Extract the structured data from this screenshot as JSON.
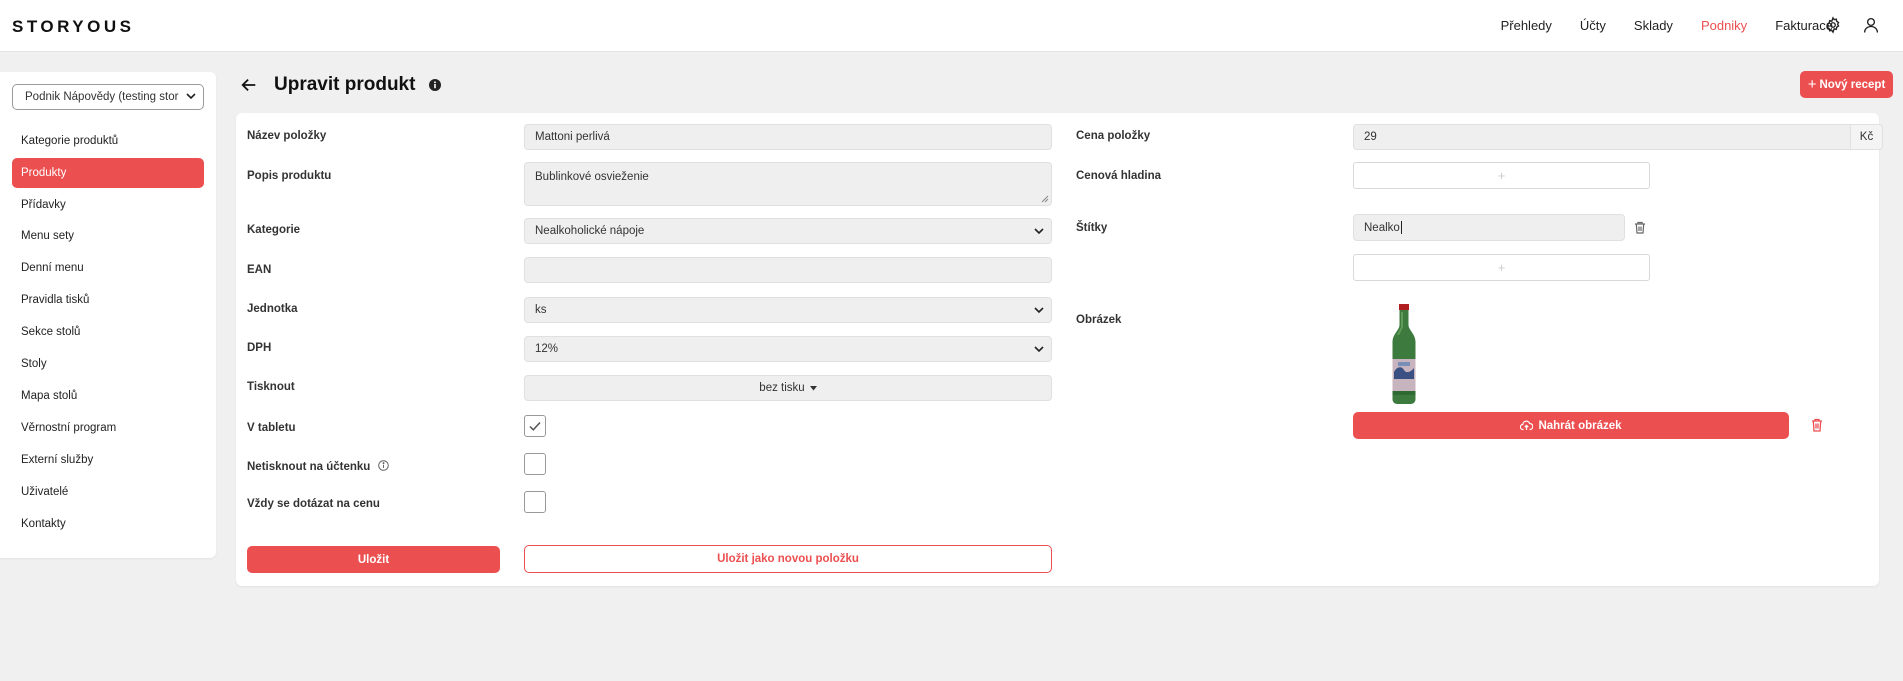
{
  "app": {
    "logo": "STORYOUS"
  },
  "nav": {
    "items": [
      {
        "label": "Přehledy",
        "active": false
      },
      {
        "label": "Účty",
        "active": false
      },
      {
        "label": "Sklady",
        "active": false
      },
      {
        "label": "Podniky",
        "active": true
      },
      {
        "label": "Fakturace",
        "active": false
      }
    ],
    "icons": [
      "gear-icon",
      "user-icon"
    ]
  },
  "sidebar": {
    "venue_select": "Podnik Nápovědy (testing stor",
    "items": [
      {
        "label": "Kategorie produktů",
        "active": false
      },
      {
        "label": "Produkty",
        "active": true
      },
      {
        "label": "Přídavky",
        "active": false
      },
      {
        "label": "Menu sety",
        "active": false
      },
      {
        "label": "Denní menu",
        "active": false
      },
      {
        "label": "Pravidla tisků",
        "active": false
      },
      {
        "label": "Sekce stolů",
        "active": false
      },
      {
        "label": "Stoly",
        "active": false
      },
      {
        "label": "Mapa stolů",
        "active": false
      },
      {
        "label": "Věrnostní program",
        "active": false
      },
      {
        "label": "Externí služby",
        "active": false
      },
      {
        "label": "Uživatelé",
        "active": false
      },
      {
        "label": "Kontakty",
        "active": false
      }
    ]
  },
  "header": {
    "title": "Upravit produkt",
    "new_recipe_label": "Nový recept"
  },
  "form": {
    "name": {
      "label": "Název položky",
      "value": "Mattoni perlivá"
    },
    "description": {
      "label": "Popis produktu",
      "value": "Bublinkové osvieženie"
    },
    "category": {
      "label": "Kategorie",
      "value": "Nealkoholické nápoje"
    },
    "ean": {
      "label": "EAN",
      "value": ""
    },
    "unit": {
      "label": "Jednotka",
      "value": "ks"
    },
    "vat": {
      "label": "DPH",
      "value": "12%"
    },
    "print": {
      "label": "Tisknout",
      "value": "bez tisku"
    },
    "tablet": {
      "label": "V tabletu",
      "checked": true
    },
    "no_receipt": {
      "label": "Netisknout na účtenku",
      "checked": false
    },
    "ask_price": {
      "label": "Vždy se dotázat na cenu",
      "checked": false
    },
    "price": {
      "label": "Cena položky",
      "value": "29",
      "currency": "Kč"
    },
    "price_level": {
      "label": "Cenová hladina",
      "add": "+"
    },
    "tags": {
      "label": "Štítky",
      "value": "Nealko",
      "add": "+"
    },
    "image": {
      "label": "Obrázek",
      "upload_label": "Nahrát obrázek"
    },
    "save_label": "Uložit",
    "save_new_label": "Uložit jako novou položku"
  },
  "colors": {
    "accent": "#ec4f50",
    "field_bg": "#efefef",
    "page_bg": "#f0f0f0"
  }
}
